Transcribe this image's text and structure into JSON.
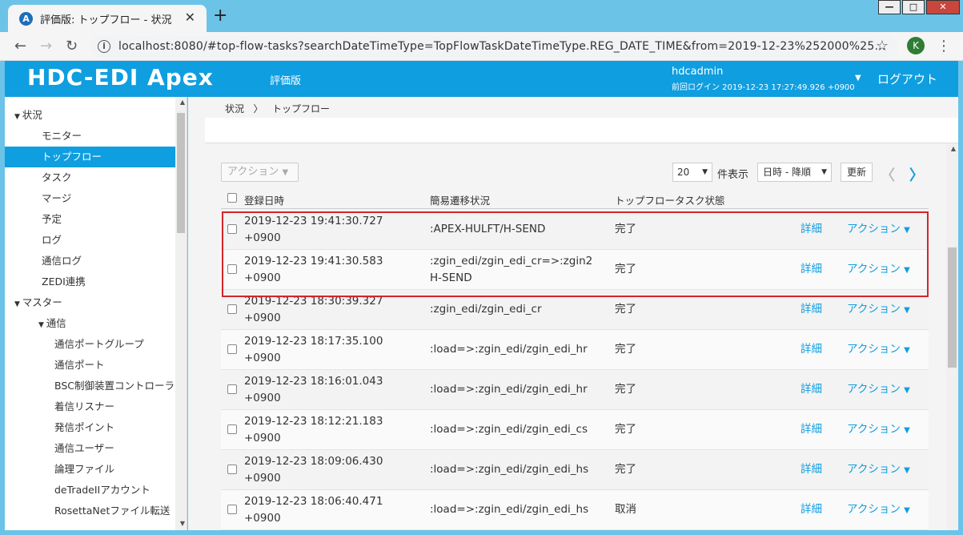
{
  "browser": {
    "tab_title": "評価版: トップフロー - 状況",
    "tab_favicon": "A",
    "url": "localhost:8080/#top-flow-tasks?searchDateTimeType=TopFlowTaskDateTimeType.REG_DATE_TIME&from=2019-12-23%252000%25…",
    "profile_initial": "K"
  },
  "header": {
    "logo": "HDC-EDI Apex",
    "edition": "評価版",
    "user_name": "hdcadmin",
    "last_login": "前回ログイン 2019-12-23 17:27:49.926 +0900",
    "logout": "ログアウト"
  },
  "sidebar": {
    "items": [
      {
        "label": "状況",
        "level": 0,
        "expanded": true
      },
      {
        "label": "モニター",
        "level": 1
      },
      {
        "label": "トップフロー",
        "level": 1,
        "active": true
      },
      {
        "label": "タスク",
        "level": 1
      },
      {
        "label": "マージ",
        "level": 1
      },
      {
        "label": "予定",
        "level": 1
      },
      {
        "label": "ログ",
        "level": 1
      },
      {
        "label": "通信ログ",
        "level": 1
      },
      {
        "label": "ZEDI連携",
        "level": 1
      },
      {
        "label": "マスター",
        "level": 0,
        "expanded": true
      },
      {
        "label": "通信",
        "level": 1,
        "expanded": true
      },
      {
        "label": "通信ポートグループ",
        "level": 2
      },
      {
        "label": "通信ポート",
        "level": 2
      },
      {
        "label": "BSC制御装置コントローラー",
        "level": 2
      },
      {
        "label": "着信リスナー",
        "level": 2
      },
      {
        "label": "発信ポイント",
        "level": 2
      },
      {
        "label": "通信ユーザー",
        "level": 2
      },
      {
        "label": "論理ファイル",
        "level": 2
      },
      {
        "label": "deTradeIIアカウント",
        "level": 2
      },
      {
        "label": "RosettaNetファイル転送",
        "level": 2
      }
    ]
  },
  "breadcrumb": [
    "状況",
    "トップフロー"
  ],
  "toolbar": {
    "action_label": "アクション",
    "per_page": "20",
    "per_page_label": "件表示",
    "sort": "日時 - 降順",
    "refresh": "更新"
  },
  "table": {
    "headers": [
      "登録日時",
      "簡易遷移状況",
      "トップフロータスク状態"
    ],
    "detail_label": "詳細",
    "action_label": "アクション",
    "rows": [
      {
        "date": "2019-12-23 19:41:30.727",
        "tz": "+0900",
        "flow": ":APEX-HULFT/H-SEND",
        "flow2": "",
        "status": "完了"
      },
      {
        "date": "2019-12-23 19:41:30.583",
        "tz": "+0900",
        "flow": ":zgin_edi/zgin_edi_cr=>:zgin2",
        "flow2": "H-SEND",
        "status": "完了"
      },
      {
        "date": "2019-12-23 18:30:39.327",
        "tz": "+0900",
        "flow": ":zgin_edi/zgin_edi_cr",
        "flow2": "",
        "status": "完了"
      },
      {
        "date": "2019-12-23 18:17:35.100",
        "tz": "+0900",
        "flow": ":load=>:zgin_edi/zgin_edi_hr",
        "flow2": "",
        "status": "完了"
      },
      {
        "date": "2019-12-23 18:16:01.043",
        "tz": "+0900",
        "flow": ":load=>:zgin_edi/zgin_edi_hr",
        "flow2": "",
        "status": "完了"
      },
      {
        "date": "2019-12-23 18:12:21.183",
        "tz": "+0900",
        "flow": ":load=>:zgin_edi/zgin_edi_cs",
        "flow2": "",
        "status": "完了"
      },
      {
        "date": "2019-12-23 18:09:06.430",
        "tz": "+0900",
        "flow": ":load=>:zgin_edi/zgin_edi_hs",
        "flow2": "",
        "status": "完了"
      },
      {
        "date": "2019-12-23 18:06:40.471",
        "tz": "+0900",
        "flow": ":load=>:zgin_edi/zgin_edi_hs",
        "flow2": "",
        "status": "取消"
      }
    ]
  },
  "colors": {
    "brand": "#0f9ee0",
    "highlight": "#d4252b"
  }
}
